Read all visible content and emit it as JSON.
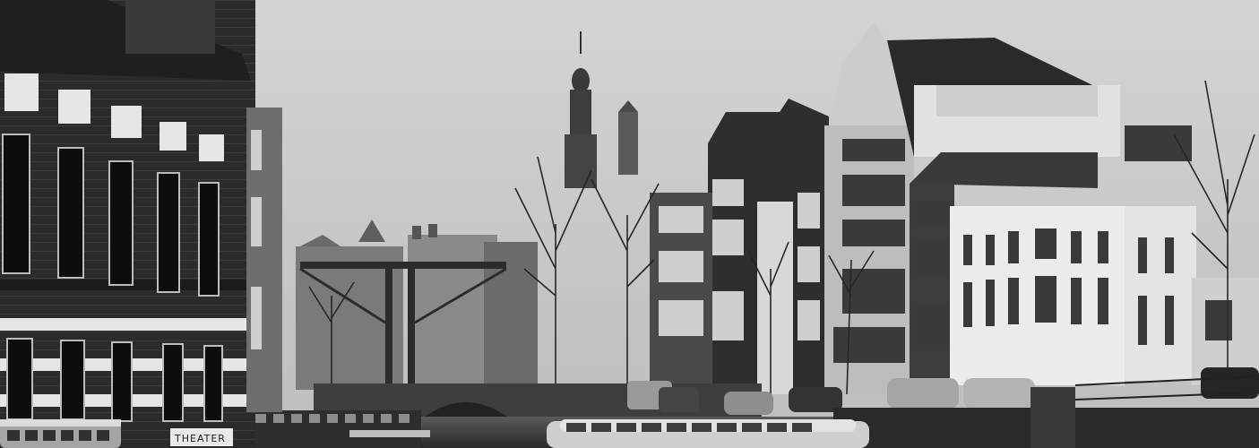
{
  "scene": {
    "kind": "black-and-white photograph",
    "palette": {
      "sky": "#cfcfcf",
      "dark": "#1a1a1a",
      "mid": "#6e6e6e",
      "light": "#e6e6e6",
      "water": "#3a3a3a"
    }
  },
  "signs": {
    "theater_sign": "THEATER"
  }
}
